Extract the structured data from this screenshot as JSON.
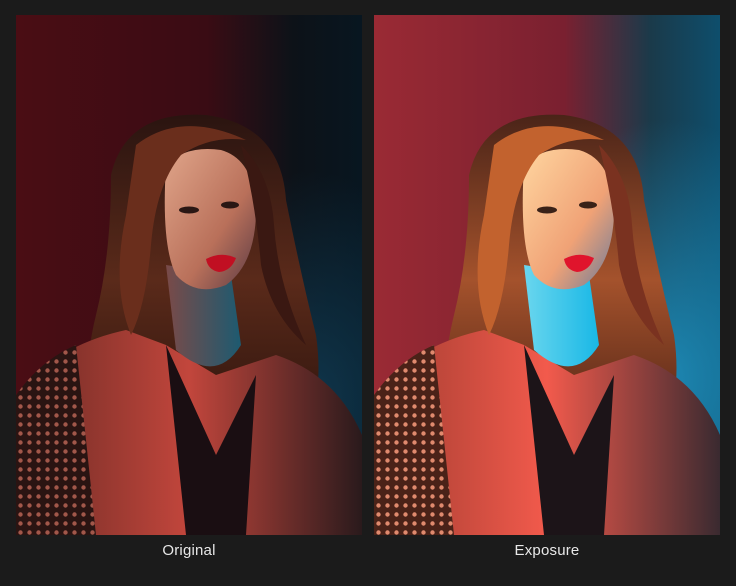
{
  "comparison": {
    "left": {
      "label": "Original",
      "adjustment_level": 0.0
    },
    "right": {
      "label": "Exposure",
      "adjustment_level": 1.0
    }
  },
  "colors": {
    "background": "#1b1b1b",
    "caption_text": "#e8e8e8",
    "red_light": "#b3202a",
    "cyan_light": "#19b8e6"
  }
}
